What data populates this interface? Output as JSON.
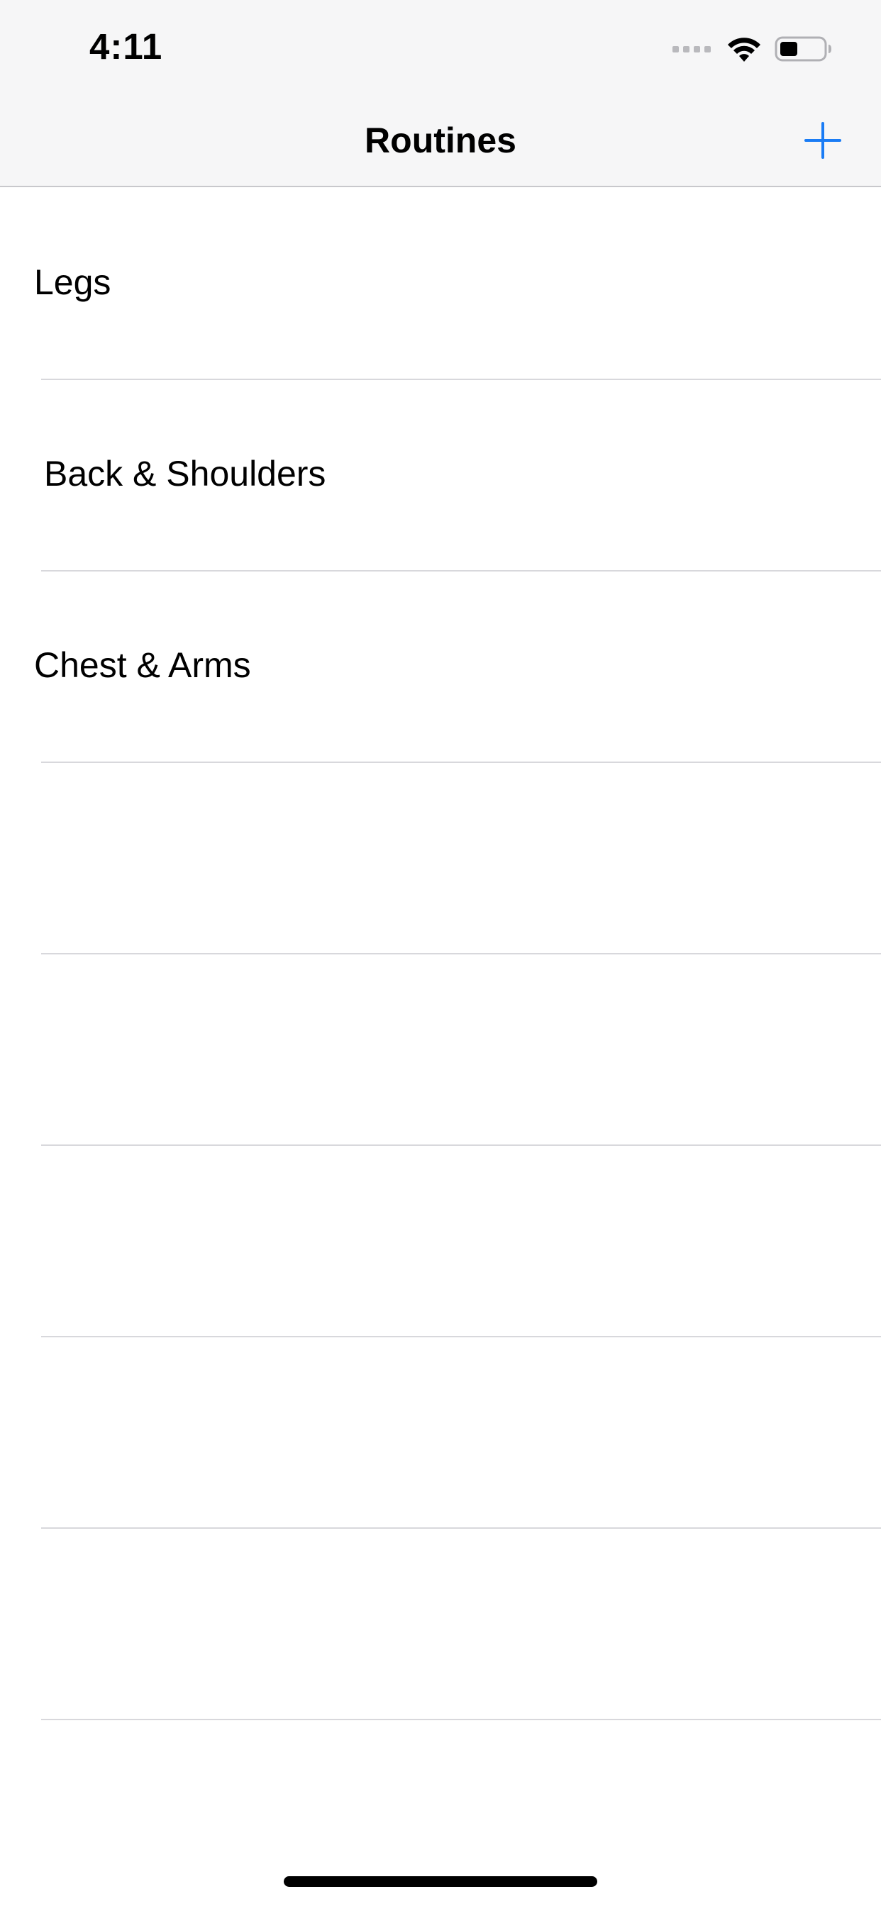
{
  "status_bar": {
    "time": "4:11",
    "icons": [
      "signal-dots-icon",
      "wifi-icon",
      "battery-icon"
    ]
  },
  "nav_bar": {
    "title": "Routines",
    "add_button_icon": "plus-icon",
    "accent_color": "#1a7cf5"
  },
  "routines": [
    {
      "label": "Legs"
    },
    {
      "label": "Back & Shoulders"
    },
    {
      "label": "Chest & Arms"
    }
  ]
}
